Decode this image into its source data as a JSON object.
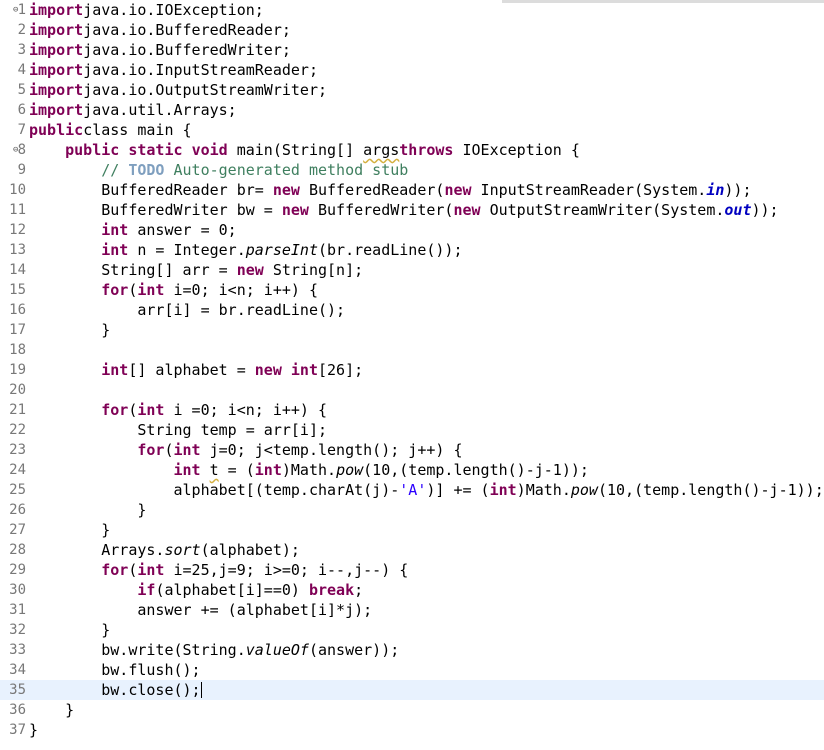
{
  "editor": {
    "language": "java",
    "current_line": 35,
    "lines": [
      {
        "n": "1",
        "fold": "⊖",
        "tokens": [
          [
            "kw",
            "import"
          ],
          [
            "",
            "java.io.IOException;"
          ]
        ]
      },
      {
        "n": "2",
        "tokens": [
          [
            "kw",
            "import"
          ],
          [
            "",
            "java.io.BufferedReader;"
          ]
        ]
      },
      {
        "n": "3",
        "tokens": [
          [
            "kw",
            "import"
          ],
          [
            "",
            "java.io.BufferedWriter;"
          ]
        ]
      },
      {
        "n": "4",
        "tokens": [
          [
            "kw",
            "import"
          ],
          [
            "",
            "java.io.InputStreamReader;"
          ]
        ]
      },
      {
        "n": "5",
        "tokens": [
          [
            "kw",
            "import"
          ],
          [
            "",
            "java.io.OutputStreamWriter;"
          ]
        ]
      },
      {
        "n": "6",
        "tokens": [
          [
            "kw",
            "import"
          ],
          [
            "",
            "java.util.Arrays;"
          ]
        ]
      },
      {
        "n": "7",
        "tokens": [
          [
            "kw",
            "public"
          ],
          [
            "",
            "class main {"
          ]
        ]
      },
      {
        "n": "8",
        "fold": "⊖",
        "tokens": [
          [
            "",
            "    "
          ],
          [
            "kw",
            "public"
          ],
          [
            "",
            " "
          ],
          [
            "kw",
            "static"
          ],
          [
            "",
            " "
          ],
          [
            "kw",
            "void"
          ],
          [
            "",
            " main(String[] "
          ],
          [
            "warn",
            "args"
          ],
          [
            ") "
          ],
          [
            "kw",
            "throws"
          ],
          [
            "",
            " IOException {"
          ]
        ]
      },
      {
        "n": "9",
        "tokens": [
          [
            "",
            "        "
          ],
          [
            "cm",
            "// "
          ],
          [
            "todo",
            "TODO"
          ],
          [
            "cm",
            " Auto-generated method stub"
          ]
        ]
      },
      {
        "n": "10",
        "tokens": [
          [
            "",
            "        BufferedReader br= "
          ],
          [
            "kw",
            "new"
          ],
          [
            "",
            " BufferedReader("
          ],
          [
            "kw",
            "new"
          ],
          [
            "",
            " InputStreamReader(System."
          ],
          [
            "st-f",
            "in"
          ],
          [
            "",
            "));"
          ]
        ]
      },
      {
        "n": "11",
        "tokens": [
          [
            "",
            "        BufferedWriter bw = "
          ],
          [
            "kw",
            "new"
          ],
          [
            "",
            " BufferedWriter("
          ],
          [
            "kw",
            "new"
          ],
          [
            "",
            " OutputStreamWriter(System."
          ],
          [
            "st-f",
            "out"
          ],
          [
            "",
            "));"
          ]
        ]
      },
      {
        "n": "12",
        "tokens": [
          [
            "",
            "        "
          ],
          [
            "kw",
            "int"
          ],
          [
            "",
            " answer = 0;"
          ]
        ]
      },
      {
        "n": "13",
        "tokens": [
          [
            "",
            "        "
          ],
          [
            "kw",
            "int"
          ],
          [
            "",
            " n = Integer."
          ],
          [
            "st-m",
            "parseInt"
          ],
          [
            "",
            "(br.readLine());"
          ]
        ]
      },
      {
        "n": "14",
        "tokens": [
          [
            "",
            "        String[] arr = "
          ],
          [
            "kw",
            "new"
          ],
          [
            "",
            " String[n];"
          ]
        ]
      },
      {
        "n": "15",
        "tokens": [
          [
            "",
            "        "
          ],
          [
            "kw",
            "for"
          ],
          [
            "",
            "("
          ],
          [
            "kw",
            "int"
          ],
          [
            "",
            " i=0; i<n; i++) {"
          ]
        ]
      },
      {
        "n": "16",
        "tokens": [
          [
            "",
            "            arr[i] = br.readLine();"
          ]
        ]
      },
      {
        "n": "17",
        "tokens": [
          [
            "",
            "        }"
          ]
        ]
      },
      {
        "n": "18",
        "tokens": [
          [
            "",
            ""
          ]
        ]
      },
      {
        "n": "19",
        "tokens": [
          [
            "",
            "        "
          ],
          [
            "kw",
            "int"
          ],
          [
            "",
            "[] alphabet = "
          ],
          [
            "kw",
            "new"
          ],
          [
            "",
            " "
          ],
          [
            "kw",
            "int"
          ],
          [
            "",
            "[26];"
          ]
        ]
      },
      {
        "n": "20",
        "tokens": [
          [
            "",
            ""
          ]
        ]
      },
      {
        "n": "21",
        "tokens": [
          [
            "",
            "        "
          ],
          [
            "kw",
            "for"
          ],
          [
            "",
            "("
          ],
          [
            "kw",
            "int"
          ],
          [
            "",
            " i =0; i<n; i++) {"
          ]
        ]
      },
      {
        "n": "22",
        "tokens": [
          [
            "",
            "            String temp = arr[i];"
          ]
        ]
      },
      {
        "n": "23",
        "tokens": [
          [
            "",
            "            "
          ],
          [
            "kw",
            "for"
          ],
          [
            "",
            "("
          ],
          [
            "kw",
            "int"
          ],
          [
            "",
            " j=0; j<temp.length(); j++) {"
          ]
        ]
      },
      {
        "n": "24",
        "tokens": [
          [
            "",
            "                "
          ],
          [
            "kw",
            "int"
          ],
          [
            "",
            " "
          ],
          [
            "unused",
            "t"
          ],
          [
            "",
            " = ("
          ],
          [
            "kw",
            "int"
          ],
          [
            "",
            ")Math."
          ],
          [
            "st-m",
            "pow"
          ],
          [
            "",
            "(10,(temp.length()-j-1));"
          ]
        ]
      },
      {
        "n": "25",
        "tokens": [
          [
            "",
            "                alphabet[(temp.charAt(j)-"
          ],
          [
            "str",
            "'A'"
          ],
          [
            "",
            ")] += ("
          ],
          [
            "kw",
            "int"
          ],
          [
            "",
            ")Math."
          ],
          [
            "st-m",
            "pow"
          ],
          [
            "",
            "(10,(temp.length()-j-1));"
          ]
        ]
      },
      {
        "n": "26",
        "tokens": [
          [
            "",
            "            }"
          ]
        ]
      },
      {
        "n": "27",
        "tokens": [
          [
            "",
            "        }"
          ]
        ]
      },
      {
        "n": "28",
        "tokens": [
          [
            "",
            "        Arrays."
          ],
          [
            "st-m",
            "sort"
          ],
          [
            "",
            "(alphabet);"
          ]
        ]
      },
      {
        "n": "29",
        "tokens": [
          [
            "",
            "        "
          ],
          [
            "kw",
            "for"
          ],
          [
            "",
            "("
          ],
          [
            "kw",
            "int"
          ],
          [
            "",
            " i=25,j=9; i>=0; i--,j--) {"
          ]
        ]
      },
      {
        "n": "30",
        "tokens": [
          [
            "",
            "            "
          ],
          [
            "kw",
            "if"
          ],
          [
            "",
            "(alphabet[i]==0) "
          ],
          [
            "kw",
            "break"
          ],
          [
            "",
            ";"
          ]
        ]
      },
      {
        "n": "31",
        "tokens": [
          [
            "",
            "            answer += (alphabet[i]*j);"
          ]
        ]
      },
      {
        "n": "32",
        "tokens": [
          [
            "",
            "        }"
          ]
        ]
      },
      {
        "n": "33",
        "tokens": [
          [
            "",
            "        bw.write(String."
          ],
          [
            "st-m",
            "valueOf"
          ],
          [
            "",
            "(answer));"
          ]
        ]
      },
      {
        "n": "34",
        "tokens": [
          [
            "",
            "        bw.flush();"
          ]
        ]
      },
      {
        "n": "35",
        "tokens": [
          [
            "",
            "        bw.close();"
          ]
        ],
        "caret": true
      },
      {
        "n": "36",
        "tokens": [
          [
            "",
            "    }"
          ]
        ]
      },
      {
        "n": "37",
        "tokens": [
          [
            "",
            "}"
          ]
        ]
      }
    ]
  }
}
